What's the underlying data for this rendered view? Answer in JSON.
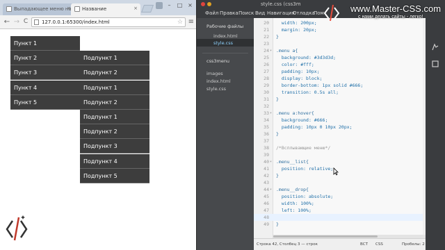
{
  "browser": {
    "tabs": [
      {
        "label": "Выпадающее меню на С"
      },
      {
        "label": "Название"
      }
    ],
    "close_glyph": "×",
    "window_buttons": [
      "–",
      "□",
      "×"
    ],
    "nav": {
      "back": "←",
      "forward": "→",
      "reload": "C"
    },
    "url": "127.0.0.1:65300/index.html",
    "star": "☆",
    "menu_glyph": "≡"
  },
  "page": {
    "menu_items": [
      "Пункт 1",
      "Пункт 2",
      "Пункт 3",
      "Пункт 4",
      "Пункт 5"
    ],
    "submenu_items": [
      "Подпункт 1",
      "Подпункт 2",
      "Подпункт 1",
      "Подпункт 2",
      "Подпункт 1",
      "Подпункт 2",
      "Подпункт 3",
      "Подпункт 4",
      "Подпункт 5"
    ]
  },
  "editor": {
    "title": "style.css (css3m",
    "menu": [
      "Файл",
      "Правка",
      "Поиск",
      "Вид",
      "Навигация",
      "Отладка",
      "Пом"
    ],
    "sidebar": {
      "working_files_header": "Рабочие файлы",
      "working_files": [
        "index.html",
        "style.css"
      ],
      "project_name": "css3menu",
      "project_items": [
        "images",
        "index.html",
        "style.css"
      ]
    },
    "code_lines": [
      {
        "n": "20",
        "fold": "",
        "text": "  width: 200px;"
      },
      {
        "n": "21",
        "fold": "",
        "text": "  margin: 20px;"
      },
      {
        "n": "22",
        "fold": "",
        "text": "}"
      },
      {
        "n": "23",
        "fold": "",
        "text": ""
      },
      {
        "n": "24",
        "fold": "▾",
        "text": ".menu a{"
      },
      {
        "n": "25",
        "fold": "",
        "text": "  background: #3d3d3d;"
      },
      {
        "n": "26",
        "fold": "",
        "text": "  color: #fff;"
      },
      {
        "n": "27",
        "fold": "",
        "text": "  padding: 10px;"
      },
      {
        "n": "28",
        "fold": "",
        "text": "  display: block;"
      },
      {
        "n": "29",
        "fold": "",
        "text": "  border-bottom: 1px solid #666;"
      },
      {
        "n": "30",
        "fold": "",
        "text": "  transition: 0.5s all;"
      },
      {
        "n": "31",
        "fold": "",
        "text": "}"
      },
      {
        "n": "32",
        "fold": "",
        "text": ""
      },
      {
        "n": "33",
        "fold": "▾",
        "text": ".menu a:hover{"
      },
      {
        "n": "34",
        "fold": "",
        "text": "  background: #666;"
      },
      {
        "n": "35",
        "fold": "",
        "text": "  padding: 10px 0 10px 20px;"
      },
      {
        "n": "36",
        "fold": "",
        "text": "}"
      },
      {
        "n": "37",
        "fold": "",
        "text": ""
      },
      {
        "n": "38",
        "fold": "",
        "text": "/*Всплывающие меню*/"
      },
      {
        "n": "39",
        "fold": "",
        "text": ""
      },
      {
        "n": "40",
        "fold": "▾",
        "text": ".menu__list{"
      },
      {
        "n": "41",
        "fold": "",
        "text": "  position: relative;"
      },
      {
        "n": "42",
        "fold": "",
        "text": "}"
      },
      {
        "n": "43",
        "fold": "",
        "text": ""
      },
      {
        "n": "44",
        "fold": "▾",
        "text": ".menu__drop{"
      },
      {
        "n": "45",
        "fold": "",
        "text": "  position: absolute;"
      },
      {
        "n": "46",
        "fold": "",
        "text": "  width: 100%;"
      },
      {
        "n": "47",
        "fold": "",
        "text": "  left: 100%;"
      },
      {
        "n": "48",
        "fold": "",
        "text": ""
      },
      {
        "n": "49",
        "fold": "",
        "text": "}"
      }
    ],
    "status": {
      "position": "Строка 42, Столбец 3 — строк",
      "insert_mode": "ВСТ",
      "language": "CSS",
      "spaces": "Пробелы: 2"
    }
  },
  "watermark": {
    "site": "www.Master-CSS.com",
    "slogan": "с нами делать сайты - легко!"
  },
  "colors": {
    "menu_bg": "#3d3d3d",
    "menu_border": "#666666",
    "selector": "#2f6f9f",
    "property": "#1f6fa8",
    "value": "#d46a35",
    "comment": "#999999"
  }
}
